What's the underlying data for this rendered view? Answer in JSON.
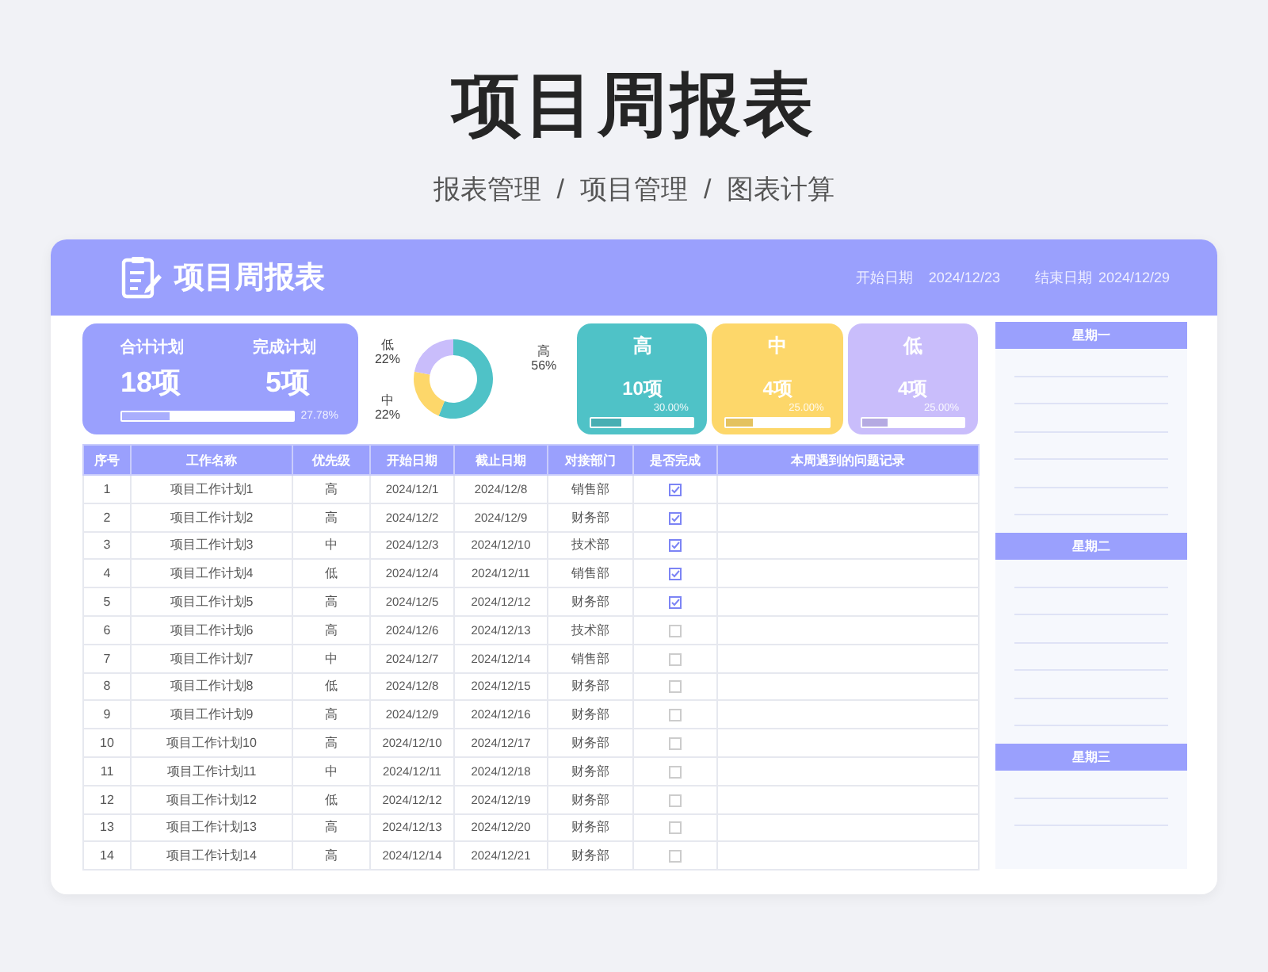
{
  "page": {
    "title": "项目周报表",
    "subtitle": [
      "报表管理",
      "/",
      "项目管理",
      "/",
      "图表计算"
    ]
  },
  "header": {
    "title": "项目周报表",
    "start_label": "开始日期",
    "start_date": "2024/12/23",
    "end_label": "结束日期",
    "end_date": "2024/12/29"
  },
  "summary": {
    "total_label": "合计计划",
    "total_value": "18项",
    "done_label": "完成计划",
    "done_value": "5项",
    "level": 0.2778,
    "percent": "27.78%"
  },
  "donut": {
    "chart_data": {
      "type": "donut",
      "categories": [
        "低",
        "中",
        "高"
      ],
      "values": [
        22,
        22,
        56
      ],
      "value_labels": [
        "22%",
        "22%",
        "56%"
      ]
    },
    "slices": [
      {
        "color": "#c9bdfb"
      },
      {
        "color": "#fdd76a"
      },
      {
        "color": "#4fc2c7"
      }
    ]
  },
  "priority_cards": [
    {
      "label": "高",
      "count": "10项",
      "percent": "30.00%",
      "level": 0.3,
      "color": "#4fc2c7"
    },
    {
      "label": "中",
      "count": "4项",
      "percent": "25.00%",
      "level": 0.25,
      "color": "#fdd76a"
    },
    {
      "label": "低",
      "count": "4项",
      "percent": "25.00%",
      "level": 0.25,
      "color": "#c9bdfb"
    }
  ],
  "table": {
    "columns": [
      "序号",
      "工作名称",
      "优先级",
      "开始日期",
      "截止日期",
      "对接部门",
      "是否完成",
      "本周遇到的问题记录"
    ],
    "rows": [
      {
        "no": "1",
        "name": "项目工作计划1",
        "priority": "高",
        "start": "2024/12/1",
        "end": "2024/12/8",
        "dept": "销售部",
        "done": true
      },
      {
        "no": "2",
        "name": "项目工作计划2",
        "priority": "高",
        "start": "2024/12/2",
        "end": "2024/12/9",
        "dept": "财务部",
        "done": true
      },
      {
        "no": "3",
        "name": "项目工作计划3",
        "priority": "中",
        "start": "2024/12/3",
        "end": "2024/12/10",
        "dept": "技术部",
        "done": true
      },
      {
        "no": "4",
        "name": "项目工作计划4",
        "priority": "低",
        "start": "2024/12/4",
        "end": "2024/12/11",
        "dept": "销售部",
        "done": true
      },
      {
        "no": "5",
        "name": "项目工作计划5",
        "priority": "高",
        "start": "2024/12/5",
        "end": "2024/12/12",
        "dept": "财务部",
        "done": true
      },
      {
        "no": "6",
        "name": "项目工作计划6",
        "priority": "高",
        "start": "2024/12/6",
        "end": "2024/12/13",
        "dept": "技术部",
        "done": false
      },
      {
        "no": "7",
        "name": "项目工作计划7",
        "priority": "中",
        "start": "2024/12/7",
        "end": "2024/12/14",
        "dept": "销售部",
        "done": false
      },
      {
        "no": "8",
        "name": "项目工作计划8",
        "priority": "低",
        "start": "2024/12/8",
        "end": "2024/12/15",
        "dept": "财务部",
        "done": false
      },
      {
        "no": "9",
        "name": "项目工作计划9",
        "priority": "高",
        "start": "2024/12/9",
        "end": "2024/12/16",
        "dept": "财务部",
        "done": false
      },
      {
        "no": "10",
        "name": "项目工作计划10",
        "priority": "高",
        "start": "2024/12/10",
        "end": "2024/12/17",
        "dept": "财务部",
        "done": false
      },
      {
        "no": "11",
        "name": "项目工作计划11",
        "priority": "中",
        "start": "2024/12/11",
        "end": "2024/12/18",
        "dept": "财务部",
        "done": false
      },
      {
        "no": "12",
        "name": "项目工作计划12",
        "priority": "低",
        "start": "2024/12/12",
        "end": "2024/12/19",
        "dept": "财务部",
        "done": false
      },
      {
        "no": "13",
        "name": "项目工作计划13",
        "priority": "高",
        "start": "2024/12/13",
        "end": "2024/12/20",
        "dept": "财务部",
        "done": false
      },
      {
        "no": "14",
        "name": "项目工作计划14",
        "priority": "高",
        "start": "2024/12/14",
        "end": "2024/12/21",
        "dept": "财务部",
        "done": false
      }
    ]
  },
  "days": [
    "星期一",
    "星期二",
    "星期三"
  ]
}
